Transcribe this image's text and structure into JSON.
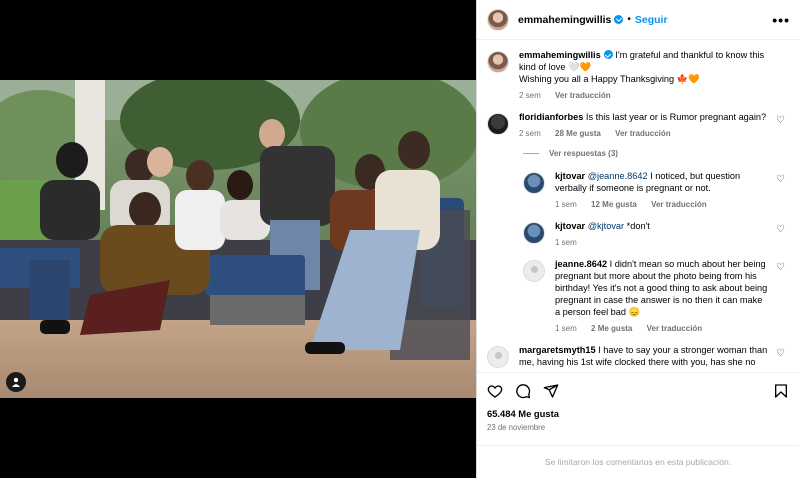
{
  "post": {
    "username": "emmahemingwillis",
    "follow_label": "Seguir",
    "more_icon": "more-options-icon"
  },
  "caption": {
    "username": "emmahemingwillis",
    "text": "I'm grateful and thankful to know this kind of love 🤍🧡",
    "text2": "Wishing you all a Happy Thanksgiving 🍁🧡",
    "time": "2 sem",
    "translate": "Ver traducción"
  },
  "comments": [
    {
      "username": "floridianforbes",
      "text": "Is this last year or is Rumor pregnant again?",
      "time": "2 sem",
      "likes": "28 Me gusta",
      "translate": "Ver traducción"
    }
  ],
  "replies_toggle": "Ver respuestas (3)",
  "replies": [
    {
      "username": "kjtovar",
      "mention": "@jeanne.8642",
      "text": " I noticed, but question verbally if someone is pregnant or not.",
      "time": "1 sem",
      "likes": "12 Me gusta",
      "translate": "Ver traducción"
    },
    {
      "username": "kjtovar",
      "mention": "@kjtovar",
      "text": " *don't",
      "time": "1 sem"
    },
    {
      "username": "jeanne.8642",
      "text": "I didn't mean so much about her being pregnant but more about the photo being from his birthday! Yes it's not a good thing to ask about being pregnant in case the answer is no then it can make a person feel bad 😞",
      "time": "1 sem",
      "likes": "2 Me gusta",
      "translate": "Ver traducción"
    }
  ],
  "partial_comment": {
    "username": "margaretsmyth15",
    "text": "I have to say your a stronger woman than me, having his 1st wife clocked there with you, has she no"
  },
  "stats": {
    "likes": "65.484 Me gusta",
    "date": "23 de noviembre"
  },
  "footer": {
    "text": "Se limitaron los comentarios en esta publicación."
  },
  "colors": {
    "accent": "#0095f6",
    "muted": "#737373"
  }
}
